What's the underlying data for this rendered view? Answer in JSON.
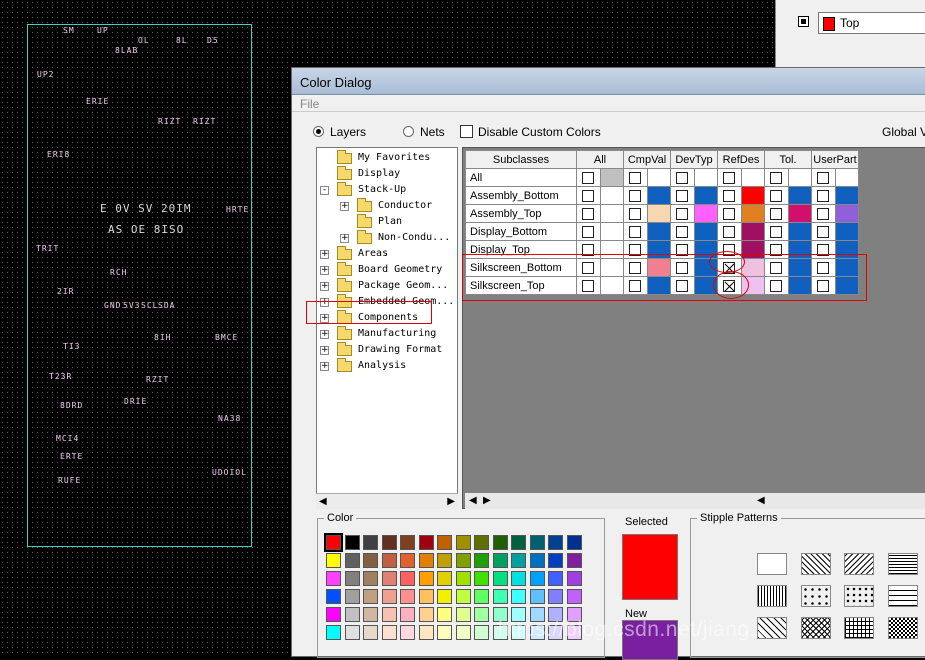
{
  "dialog": {
    "title": "Color Dialog",
    "menu_file": "File",
    "radio_layers": "Layers",
    "radio_nets": "Nets",
    "disable_custom_colors": "Disable Custom Colors",
    "global_visibility": "Global Vi"
  },
  "layer_selector": {
    "value": "Top",
    "color": "#ff0000"
  },
  "tree": {
    "items": [
      {
        "label": "My Favorites",
        "expander": ""
      },
      {
        "label": "Display",
        "expander": ""
      },
      {
        "label": "Stack-Up",
        "expander": "-"
      },
      {
        "label": "Conductor",
        "expander": "+"
      },
      {
        "label": "Plan",
        "expander": ""
      },
      {
        "label": "Non-Condu...",
        "expander": "+"
      },
      {
        "label": "Areas",
        "expander": "+"
      },
      {
        "label": "Board Geometry",
        "expander": "+"
      },
      {
        "label": "Package Geom...",
        "expander": "+"
      },
      {
        "label": "Embedded Geom...",
        "expander": "+"
      },
      {
        "label": "Components",
        "expander": "+"
      },
      {
        "label": "Manufacturing",
        "expander": "+"
      },
      {
        "label": "Drawing Format",
        "expander": "+"
      },
      {
        "label": "Analysis",
        "expander": "+"
      }
    ]
  },
  "grid": {
    "headers": [
      "Subclasses",
      "All",
      "CmpVal",
      "DevTyp",
      "RefDes",
      "Tol.",
      "UserPart"
    ],
    "rows": [
      {
        "name": "All",
        "colors": [
          "#c0c0c0",
          "",
          "",
          "",
          "",
          ""
        ],
        "x": [
          false,
          false,
          false,
          false,
          false,
          false
        ]
      },
      {
        "name": "Assembly_Bottom",
        "colors": [
          "#ffffff",
          "#1060c0",
          "#1060c0",
          "#ff0000",
          "#1060c0",
          "#1060c0"
        ],
        "x": [
          false,
          false,
          false,
          false,
          false,
          false
        ]
      },
      {
        "name": "Assembly_Top",
        "colors": [
          "#ffffff",
          "#f8d8b0",
          "#ff60ff",
          "#e08020",
          "#d0106a",
          "#9060d8"
        ],
        "x": [
          false,
          false,
          false,
          false,
          false,
          false
        ]
      },
      {
        "name": "Display_Bottom",
        "colors": [
          "#ffffff",
          "#1060c0",
          "#1060c0",
          "#a01060",
          "#1060c0",
          "#1060c0"
        ],
        "x": [
          false,
          false,
          false,
          false,
          false,
          false
        ]
      },
      {
        "name": "Display_Top",
        "colors": [
          "#ffffff",
          "#1060c0",
          "#1060c0",
          "#a01060",
          "#1060c0",
          "#1060c0"
        ],
        "x": [
          false,
          false,
          false,
          false,
          false,
          false
        ]
      },
      {
        "name": "Silkscreen_Bottom",
        "colors": [
          "#ffffff",
          "#f08090",
          "#1060c0",
          "#f0c0e0",
          "#1060c0",
          "#1060c0"
        ],
        "x": [
          false,
          false,
          false,
          true,
          false,
          false
        ]
      },
      {
        "name": "Silkscreen_Top",
        "colors": [
          "#ffffff",
          "#1060c0",
          "#1060c0",
          "#f0c0f0",
          "#1060c0",
          "#1060c0"
        ],
        "x": [
          false,
          false,
          false,
          true,
          false,
          false
        ]
      }
    ]
  },
  "color_panel": {
    "title": "Color",
    "selected_label": "Selected",
    "new_label": "New",
    "stipple_title": "Stipple Patterns",
    "selected_color": "#ff0000",
    "new_color": "#7a1fa0",
    "palette": [
      "#ff0000",
      "#000000",
      "#404040",
      "#603020",
      "#804020",
      "#a00010",
      "#c06000",
      "#a09000",
      "#607000",
      "#206000",
      "#006040",
      "#006070",
      "#004090",
      "#003090",
      "#ffff00",
      "#606060",
      "#806040",
      "#c06040",
      "#e06030",
      "#e08000",
      "#c0a000",
      "#80a000",
      "#20a000",
      "#00a060",
      "#00a0a0",
      "#0070c0",
      "#0040c0",
      "#8020a0",
      "#ff40ff",
      "#808080",
      "#a08060",
      "#e08070",
      "#ff6060",
      "#ffa000",
      "#e0d000",
      "#a0e000",
      "#40e000",
      "#00e080",
      "#00e0e0",
      "#00a0ff",
      "#4060ff",
      "#a040e0",
      "#0050ff",
      "#a0a0a0",
      "#c0a080",
      "#f0a090",
      "#ff9090",
      "#ffc060",
      "#f0f000",
      "#c0ff40",
      "#60ff60",
      "#40ffb0",
      "#40ffff",
      "#60c0ff",
      "#8080ff",
      "#c060ff",
      "#ff00ff",
      "#c0c0c0",
      "#d0b8a0",
      "#f8c0b0",
      "#ffb0c0",
      "#ffd090",
      "#ffff80",
      "#e0ff90",
      "#a0ffa0",
      "#90ffd0",
      "#a0ffff",
      "#a0d8ff",
      "#b0b0ff",
      "#e0a0ff",
      "#00ffff",
      "#e0e0e0",
      "#e8d8c8",
      "#ffe0d0",
      "#ffd8e0",
      "#ffe8c0",
      "#ffffc0",
      "#f0ffc8",
      "#d0ffd0",
      "#d0fff0",
      "#d0ffff",
      "#d0ecff",
      "#d8d8ff",
      "#f0d0ff"
    ]
  },
  "pcb_text": {
    "big1": "E 0V SV 20IM",
    "big2": "AS OE 8ISO",
    "labels": [
      "SM",
      "UP",
      "OL",
      "8L",
      "D5",
      "8LAB",
      "UP2",
      "ERIE",
      "RIZT",
      "RIZT",
      "ERI8",
      "HRTE",
      "TRIT",
      "RCH",
      "2IR",
      "GND",
      "5V3",
      "SCL",
      "SDA",
      "TI3",
      "BMCE",
      "8IH",
      "T23R",
      "MCI4",
      "NA38",
      "UDOIOL",
      "8DRD",
      "ERTE",
      "RUFE",
      "DRIE",
      "RZIT"
    ]
  },
  "watermark": "https://blog.csdn.net/jiang..."
}
